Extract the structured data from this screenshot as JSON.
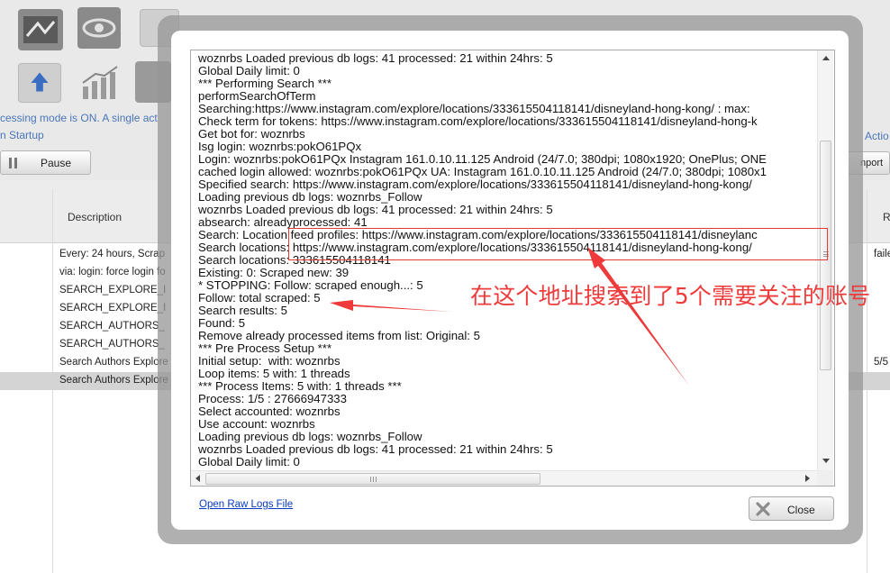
{
  "background": {
    "info_line": "cessing mode is ON. A single act",
    "info_line2": "n Startup",
    "pause_label": "Pause",
    "actions_label": "Actio",
    "import_label": "nport",
    "grid": {
      "header_description": "Description",
      "header_right": "R",
      "rows": [
        {
          "desc": "Every: 24 hours, Scrap",
          "right": "faile"
        },
        {
          "desc": "via: login:  force login fo",
          "right": ""
        },
        {
          "desc": "SEARCH_EXPLORE_I",
          "right": ""
        },
        {
          "desc": "SEARCH_EXPLORE_I",
          "right": ""
        },
        {
          "desc": "SEARCH_AUTHORS_",
          "right": ""
        },
        {
          "desc": "SEARCH_AUTHORS_",
          "right": ""
        },
        {
          "desc": "Search Authors Explore",
          "right": "5/5"
        },
        {
          "desc": "Search Authors Explore",
          "right": ""
        }
      ]
    }
  },
  "dialog": {
    "log_lines": [
      "woznrbs Loaded previous db logs: 41 processed: 21 within 24hrs: 5",
      "Global Daily limit: 0",
      "*** Performing Search ***",
      "performSearchOfTerm",
      "Searching:https://www.instagram.com/explore/locations/333615504118141/disneyland-hong-kong/ : max:",
      "Check term for tokens: https://www.instagram.com/explore/locations/333615504118141/disneyland-hong-k",
      "Get bot for: woznrbs",
      "Isg login: woznrbs:pokO61PQx",
      "Login: woznrbs:pokO61PQx Instagram 161.0.10.11.125 Android (24/7.0; 380dpi; 1080x1920; OnePlus; ONE",
      "cached login allowed: woznrbs:pokO61PQx UA: Instagram 161.0.10.11.125 Android (24/7.0; 380dpi; 1080x1",
      "Specified search: https://www.instagram.com/explore/locations/333615504118141/disneyland-hong-kong/",
      "Loading previous db logs: woznrbs_Follow",
      "woznrbs Loaded previous db logs: 41 processed: 21 within 24hrs: 5",
      "absearch: alreadyprocessed: 41",
      "Search: Location feed profiles: https://www.instagram.com/explore/locations/333615504118141/disneylanc",
      "Search locations: https://www.instagram.com/explore/locations/333615504118141/disneyland-hong-kong/",
      "Search locations: 333615504118141",
      "Existing: 0: Scraped new: 39",
      "* STOPPING: Follow: scraped enough...: 5",
      "Follow: total scraped: 5",
      "Search results: 5",
      "Found: 5",
      "Remove already processed items from list: Original: 5",
      "*** Pre Process Setup ***",
      "Initial setup:  with: woznrbs",
      "Loop items: 5 with: 1 threads",
      "*** Process Items: 5 with: 1 threads ***",
      "Process: 1/5 : 27666947333",
      "Select accounted: woznrbs",
      "Use account: woznrbs",
      "Loading previous db logs: woznrbs_Follow",
      "woznrbs Loaded previous db logs: 41 processed: 21 within 24hrs: 5",
      "Global Daily limit: 0"
    ],
    "annotation_text": "在这个地址搜索到了5个需要关注的账号",
    "raw_link_label": "Open Raw Logs File",
    "close_label": "Close"
  },
  "colors": {
    "annotation": "#ee3a3a",
    "link": "#0a3bc4",
    "info_text": "#4b76b8"
  }
}
